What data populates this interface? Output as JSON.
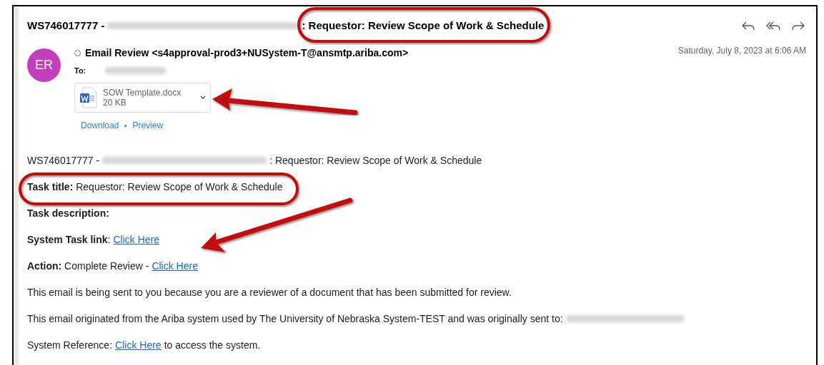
{
  "subject": {
    "prefix": "WS746017777 -",
    "suffix": ": Requestor: Review Scope of Work & Schedule"
  },
  "sender": {
    "initials": "ER",
    "name": "Email Review <s4approval-prod3+NUSystem-T@ansmtp.ariba.com>",
    "date": "Saturday, July 8, 2023 at 6:06 AM"
  },
  "to_label": "To:",
  "attachment": {
    "name": "SOW Template.docx",
    "size": "20 KB",
    "actions": [
      "Download",
      "Preview"
    ]
  },
  "body": [
    {
      "segments": [
        {
          "kind": "text",
          "text": "WS746017777 -"
        },
        {
          "kind": "blur"
        },
        {
          "kind": "text",
          "text": ": Requestor: Review Scope of Work & Schedule"
        }
      ]
    },
    {
      "segments": [
        {
          "kind": "text",
          "text": "**Task title:** Requestor: Review Scope of Work & Schedule"
        }
      ]
    },
    {
      "segments": [
        {
          "kind": "text",
          "text": "**Task description:**"
        }
      ]
    },
    {
      "segments": [
        {
          "kind": "text",
          "text": "**System Task link**:"
        },
        {
          "kind": "link",
          "text": "Click Here"
        }
      ]
    },
    {
      "segments": [
        {
          "kind": "text",
          "text": "**Action:** Complete Review -"
        },
        {
          "kind": "link",
          "text": "Click Here"
        }
      ]
    },
    {
      "segments": [
        {
          "kind": "text",
          "text": "This email is being sent to you because you are a reviewer of a document that has been submitted for review."
        }
      ]
    },
    {
      "segments": [
        {
          "kind": "text",
          "text": "This email originated from the Ariba system used by The University of Nebraska System-TEST and was originally sent to:"
        },
        {
          "kind": "blur"
        }
      ]
    },
    {
      "segments": [
        {
          "kind": "text",
          "text": "System Reference:"
        },
        {
          "kind": "link",
          "text": "Click Here"
        },
        {
          "kind": "text",
          "text": "to access the system."
        }
      ]
    }
  ]
}
